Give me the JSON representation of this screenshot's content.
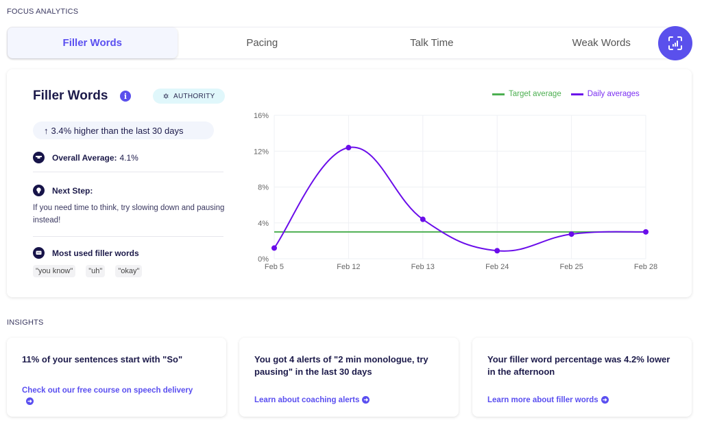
{
  "header": {
    "section_label": "FOCUS ANALYTICS"
  },
  "tabs": [
    {
      "label": "Filler Words",
      "active": true
    },
    {
      "label": "Pacing",
      "active": false
    },
    {
      "label": "Talk Time",
      "active": false
    },
    {
      "label": "Weak Words",
      "active": false
    }
  ],
  "fab": {
    "icon": "analytics-scan-icon"
  },
  "summary": {
    "title": "Filler Words",
    "info_icon": "info-icon",
    "badge": {
      "icon": "star-of-david-icon",
      "label": "AUTHORITY"
    },
    "trend": {
      "icon": "arrow-up-icon",
      "text": "3.4% higher than the last 30 days"
    },
    "overall_average": {
      "label": "Overall Average:",
      "value": "4.1%"
    },
    "next_step": {
      "label": "Next Step:",
      "text": "If you need time to think, try slowing down and pausing instead!"
    },
    "most_used": {
      "label": "Most used filler words",
      "words": [
        "\"you know\"",
        "\"uh\"",
        "\"okay\""
      ]
    }
  },
  "colors": {
    "accent": "#5a4ff0",
    "target": "#4caf50",
    "daily": "#6a0dea"
  },
  "chart_data": {
    "type": "line",
    "title": "",
    "xlabel": "",
    "ylabel": "",
    "categories": [
      "Feb 5",
      "Feb 12",
      "Feb 13",
      "Feb 24",
      "Feb 25",
      "Feb 28"
    ],
    "yticks": [
      "0%",
      "4%",
      "8%",
      "12%",
      "16%"
    ],
    "ylim": [
      0,
      16
    ],
    "grid": true,
    "legend": "top-right",
    "series": [
      {
        "name": "Target average",
        "values": [
          3.0,
          3.0,
          3.0,
          3.0,
          3.0,
          3.0
        ],
        "color": "#4caf50",
        "smooth": false,
        "markers": false
      },
      {
        "name": "Daily averages",
        "values": [
          1.2,
          12.4,
          4.4,
          0.9,
          2.75,
          3.0
        ],
        "color": "#6a0dea",
        "smooth": true,
        "markers": true
      }
    ]
  },
  "insights": {
    "section_label": "INSIGHTS",
    "cards": [
      {
        "headline": "11% of your sentences start with \"So\"",
        "link": "Check out our free course on speech delivery"
      },
      {
        "headline": "You got 4 alerts of \"2 min monologue, try pausing\" in the last 30 days",
        "link": "Learn about coaching alerts"
      },
      {
        "headline": "Your filler word percentage was 4.2% lower in the afternoon",
        "link": "Learn more about filler words"
      }
    ]
  }
}
